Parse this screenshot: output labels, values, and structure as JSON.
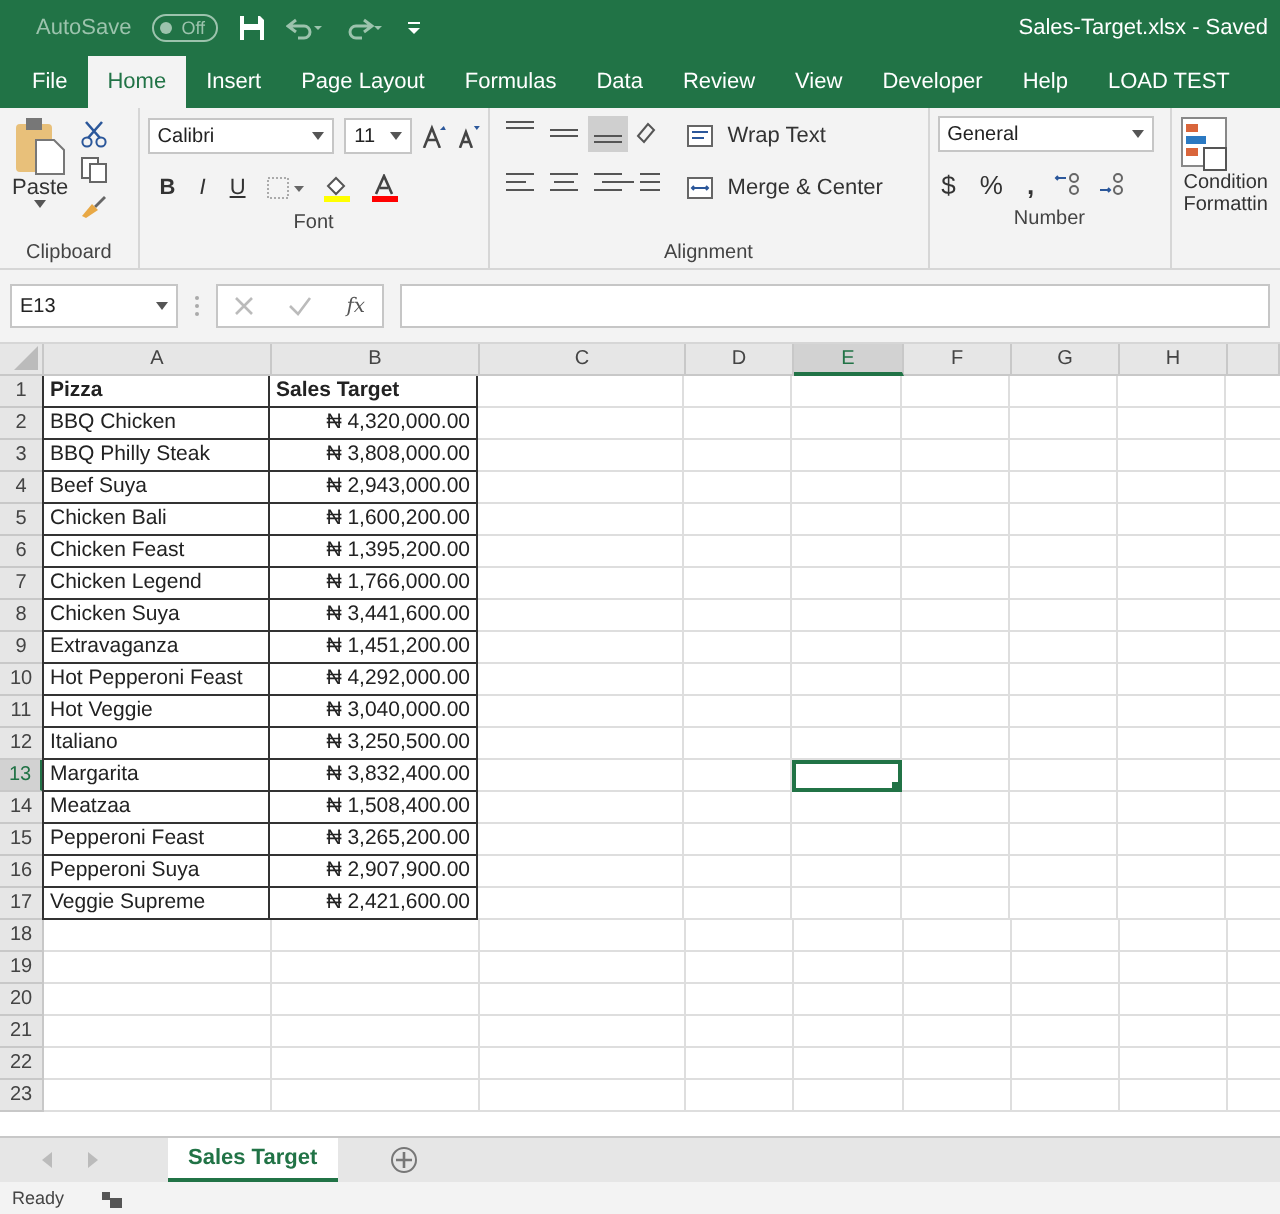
{
  "title_bar": {
    "autosave_label": "AutoSave",
    "autosave_toggle": "Off",
    "autosave_on": false,
    "title": "Sales-Target.xlsx  -  Saved"
  },
  "ribbon_tabs": [
    {
      "label": "File",
      "selected": false
    },
    {
      "label": "Home",
      "selected": true
    },
    {
      "label": "Insert",
      "selected": false
    },
    {
      "label": "Page Layout",
      "selected": false
    },
    {
      "label": "Formulas",
      "selected": false
    },
    {
      "label": "Data",
      "selected": false
    },
    {
      "label": "Review",
      "selected": false
    },
    {
      "label": "View",
      "selected": false
    },
    {
      "label": "Developer",
      "selected": false
    },
    {
      "label": "Help",
      "selected": false
    },
    {
      "label": "LOAD TEST",
      "selected": false
    }
  ],
  "ribbon": {
    "clipboard": {
      "paste": "Paste",
      "group": "Clipboard"
    },
    "font": {
      "font_name": "Calibri",
      "font_size": "11",
      "bold": "B",
      "italic": "I",
      "underline": "U",
      "group": "Font"
    },
    "alignment": {
      "wrap_text": "Wrap Text",
      "merge_center": "Merge & Center",
      "group": "Alignment"
    },
    "number": {
      "format": "General",
      "currency": "$",
      "percent": "%",
      "comma": ",",
      "group": "Number"
    },
    "styles": {
      "line_1": "Condition",
      "line_2": "Formattin"
    }
  },
  "formula_bar": {
    "name_box": "E13",
    "function_label": "fx"
  },
  "columns": [
    {
      "label": "A",
      "selected": false
    },
    {
      "label": "B",
      "selected": false
    },
    {
      "label": "C",
      "selected": false
    },
    {
      "label": "D",
      "selected": false
    },
    {
      "label": "E",
      "selected": true
    },
    {
      "label": "F",
      "selected": false
    },
    {
      "label": "G",
      "selected": false
    },
    {
      "label": "H",
      "selected": false
    }
  ],
  "rows": [
    {
      "number": "1",
      "selected": false,
      "bold": true,
      "cells": [
        "Pizza",
        "Sales Target"
      ]
    },
    {
      "number": "2",
      "selected": false,
      "bold": false,
      "cells": [
        "BBQ Chicken",
        "₦ 4,320,000.00"
      ]
    },
    {
      "number": "3",
      "selected": false,
      "bold": false,
      "cells": [
        "BBQ Philly Steak",
        "₦ 3,808,000.00"
      ]
    },
    {
      "number": "4",
      "selected": false,
      "bold": false,
      "cells": [
        "Beef Suya",
        "₦ 2,943,000.00"
      ]
    },
    {
      "number": "5",
      "selected": false,
      "bold": false,
      "cells": [
        "Chicken Bali",
        "₦ 1,600,200.00"
      ]
    },
    {
      "number": "6",
      "selected": false,
      "bold": false,
      "cells": [
        "Chicken Feast",
        "₦ 1,395,200.00"
      ]
    },
    {
      "number": "7",
      "selected": false,
      "bold": false,
      "cells": [
        "Chicken Legend",
        "₦ 1,766,000.00"
      ]
    },
    {
      "number": "8",
      "selected": false,
      "bold": false,
      "cells": [
        "Chicken Suya",
        "₦ 3,441,600.00"
      ]
    },
    {
      "number": "9",
      "selected": false,
      "bold": false,
      "cells": [
        "Extravaganza",
        "₦ 1,451,200.00"
      ]
    },
    {
      "number": "10",
      "selected": false,
      "bold": false,
      "cells": [
        "Hot Pepperoni Feast",
        "₦ 4,292,000.00"
      ]
    },
    {
      "number": "11",
      "selected": false,
      "bold": false,
      "cells": [
        "Hot Veggie",
        "₦ 3,040,000.00"
      ]
    },
    {
      "number": "12",
      "selected": false,
      "bold": false,
      "cells": [
        "Italiano",
        "₦ 3,250,500.00"
      ]
    },
    {
      "number": "13",
      "selected": true,
      "bold": false,
      "cells": [
        "Margarita",
        "₦ 3,832,400.00"
      ]
    },
    {
      "number": "14",
      "selected": false,
      "bold": false,
      "cells": [
        "Meatzaa",
        "₦ 1,508,400.00"
      ]
    },
    {
      "number": "15",
      "selected": false,
      "bold": false,
      "cells": [
        "Pepperoni Feast",
        "₦ 3,265,200.00"
      ]
    },
    {
      "number": "16",
      "selected": false,
      "bold": false,
      "cells": [
        "Pepperoni Suya",
        "₦ 2,907,900.00"
      ]
    },
    {
      "number": "17",
      "selected": false,
      "bold": false,
      "cells": [
        "Veggie Supreme",
        "₦ 2,421,600.00"
      ]
    },
    {
      "number": "18",
      "selected": false
    },
    {
      "number": "19",
      "selected": false
    },
    {
      "number": "20",
      "selected": false
    },
    {
      "number": "21",
      "selected": false
    },
    {
      "number": "22",
      "selected": false
    },
    {
      "number": "23",
      "selected": false
    }
  ],
  "sheet_tabs": [
    {
      "label": "Sales Target",
      "selected": true
    }
  ],
  "status_bar": {
    "status": "Ready"
  }
}
